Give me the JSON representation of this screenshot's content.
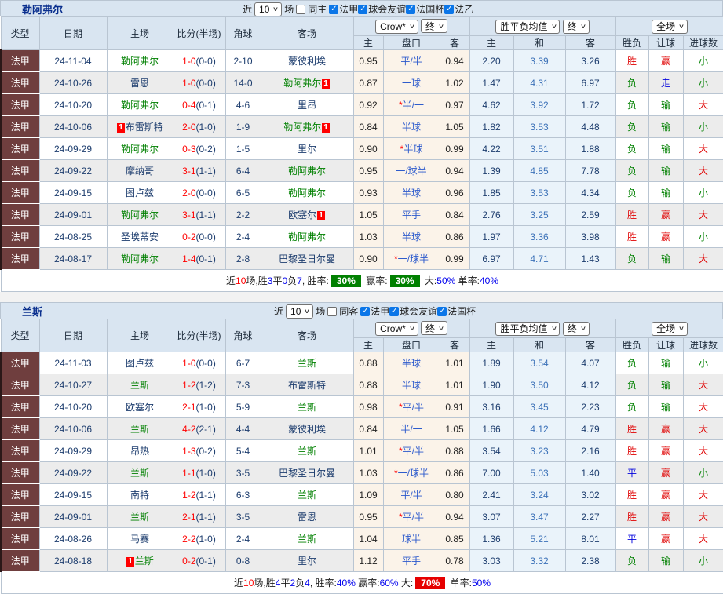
{
  "colors": {
    "header_bg": "#d9e5f1",
    "type_cell_bg": "#6f3e3e",
    "team_highlight_green": "#008000",
    "score_red": "#ff0000",
    "win_red": "#e00000",
    "draw_blue": "#0000dd",
    "lose_green": "#008000",
    "handicap_col_bg": "#fbf3e9",
    "odds_col_bg": "#eaf3fa",
    "badge_green": "#008000",
    "badge_red": "#e60000"
  },
  "headers": {
    "type": "类型",
    "date": "日期",
    "home": "主场",
    "score": "比分(半场)",
    "corner": "角球",
    "away": "客场",
    "h_home": "主",
    "h_line": "盘口",
    "h_away": "客",
    "o_home": "主",
    "o_draw": "和",
    "o_away": "客",
    "result": "胜负",
    "h_result": "让球",
    "goals": "进球数"
  },
  "tables": [
    {
      "title": "勒阿弗尔",
      "filter": {
        "near": "近",
        "count": "10",
        "matches": "场",
        "same": "同主"
      },
      "leagues": [
        "法甲",
        "球会友谊",
        "法国杯",
        "法乙"
      ],
      "dropdowns": {
        "bookmaker": "Crow*",
        "bookmaker_time": "终",
        "avg": "胜平负均值",
        "avg_time": "终",
        "scope": "全场"
      },
      "rows": [
        {
          "league": "法甲",
          "date": "24-11-04",
          "home": "勒阿弗尔",
          "hg": true,
          "hc": "",
          "away": "蒙彼利埃",
          "ag": false,
          "ac": "",
          "score": "1-0",
          "half": "(0-0)",
          "corner": "2-10",
          "ah": "0.95",
          "line": "平/半",
          "star": false,
          "aa": "0.94",
          "o1": "2.20",
          "o2": "3.39",
          "o3": "3.26",
          "res": "胜",
          "hres": "赢",
          "goal": "小"
        },
        {
          "league": "法甲",
          "date": "24-10-26",
          "home": "雷恩",
          "hg": false,
          "hc": "",
          "away": "勒阿弗尔",
          "ag": true,
          "ac": "1",
          "score": "1-0",
          "half": "(0-0)",
          "corner": "14-0",
          "ah": "0.87",
          "line": "一球",
          "star": false,
          "aa": "1.02",
          "o1": "1.47",
          "o2": "4.31",
          "o3": "6.97",
          "res": "负",
          "hres": "走",
          "goal": "小"
        },
        {
          "league": "法甲",
          "date": "24-10-20",
          "home": "勒阿弗尔",
          "hg": true,
          "hc": "",
          "away": "里昂",
          "ag": false,
          "ac": "",
          "score": "0-4",
          "half": "(0-1)",
          "corner": "4-6",
          "ah": "0.92",
          "line": "半/一",
          "star": true,
          "aa": "0.97",
          "o1": "4.62",
          "o2": "3.92",
          "o3": "1.72",
          "res": "负",
          "hres": "输",
          "goal": "大"
        },
        {
          "league": "法甲",
          "date": "24-10-06",
          "home": "布雷斯特",
          "hg": false,
          "hc": "1",
          "away": "勒阿弗尔",
          "ag": true,
          "ac": "1",
          "score": "2-0",
          "half": "(1-0)",
          "corner": "1-9",
          "ah": "0.84",
          "line": "半球",
          "star": false,
          "aa": "1.05",
          "o1": "1.82",
          "o2": "3.53",
          "o3": "4.48",
          "res": "负",
          "hres": "输",
          "goal": "小"
        },
        {
          "league": "法甲",
          "date": "24-09-29",
          "home": "勒阿弗尔",
          "hg": true,
          "hc": "",
          "away": "里尔",
          "ag": false,
          "ac": "",
          "score": "0-3",
          "half": "(0-2)",
          "corner": "1-5",
          "ah": "0.90",
          "line": "半球",
          "star": true,
          "aa": "0.99",
          "o1": "4.22",
          "o2": "3.51",
          "o3": "1.88",
          "res": "负",
          "hres": "输",
          "goal": "大"
        },
        {
          "league": "法甲",
          "date": "24-09-22",
          "home": "摩纳哥",
          "hg": false,
          "hc": "",
          "away": "勒阿弗尔",
          "ag": true,
          "ac": "",
          "score": "3-1",
          "half": "(1-1)",
          "corner": "6-4",
          "ah": "0.95",
          "line": "一/球半",
          "star": false,
          "aa": "0.94",
          "o1": "1.39",
          "o2": "4.85",
          "o3": "7.78",
          "res": "负",
          "hres": "输",
          "goal": "大"
        },
        {
          "league": "法甲",
          "date": "24-09-15",
          "home": "图卢兹",
          "hg": false,
          "hc": "",
          "away": "勒阿弗尔",
          "ag": true,
          "ac": "",
          "score": "2-0",
          "half": "(0-0)",
          "corner": "6-5",
          "ah": "0.93",
          "line": "半球",
          "star": false,
          "aa": "0.96",
          "o1": "1.85",
          "o2": "3.53",
          "o3": "4.34",
          "res": "负",
          "hres": "输",
          "goal": "小"
        },
        {
          "league": "法甲",
          "date": "24-09-01",
          "home": "勒阿弗尔",
          "hg": true,
          "hc": "",
          "away": "欧塞尔",
          "ag": false,
          "ac": "1",
          "score": "3-1",
          "half": "(1-1)",
          "corner": "2-2",
          "ah": "1.05",
          "line": "平手",
          "star": false,
          "aa": "0.84",
          "o1": "2.76",
          "o2": "3.25",
          "o3": "2.59",
          "res": "胜",
          "hres": "赢",
          "goal": "大"
        },
        {
          "league": "法甲",
          "date": "24-08-25",
          "home": "圣埃蒂安",
          "hg": false,
          "hc": "",
          "away": "勒阿弗尔",
          "ag": true,
          "ac": "",
          "score": "0-2",
          "half": "(0-0)",
          "corner": "2-4",
          "ah": "1.03",
          "line": "半球",
          "star": false,
          "aa": "0.86",
          "o1": "1.97",
          "o2": "3.36",
          "o3": "3.98",
          "res": "胜",
          "hres": "赢",
          "goal": "小"
        },
        {
          "league": "法甲",
          "date": "24-08-17",
          "home": "勒阿弗尔",
          "hg": true,
          "hc": "",
          "away": "巴黎圣日尔曼",
          "ag": false,
          "ac": "",
          "score": "1-4",
          "half": "(0-1)",
          "corner": "2-8",
          "ah": "0.90",
          "line": "一/球半",
          "star": true,
          "aa": "0.99",
          "o1": "6.97",
          "o2": "4.71",
          "o3": "1.43",
          "res": "负",
          "hres": "输",
          "goal": "大"
        }
      ],
      "summary": [
        {
          "text": "近",
          "style": "plain"
        },
        {
          "text": "10",
          "style": "red"
        },
        {
          "text": "场,胜",
          "style": "plain"
        },
        {
          "text": "3",
          "style": "blue"
        },
        {
          "text": "平",
          "style": "plain"
        },
        {
          "text": "0",
          "style": "blue"
        },
        {
          "text": "负",
          "style": "plain"
        },
        {
          "text": "7",
          "style": "blue"
        },
        {
          "text": ", 胜率:",
          "style": "plain"
        },
        {
          "text": "30%",
          "style": "badge-green"
        },
        {
          "text": " 赢率:",
          "style": "plain"
        },
        {
          "text": "30%",
          "style": "badge-green"
        },
        {
          "text": " 大:",
          "style": "plain"
        },
        {
          "text": "50%",
          "style": "blue"
        },
        {
          "text": " 单率:",
          "style": "plain"
        },
        {
          "text": "40%",
          "style": "blue"
        }
      ]
    },
    {
      "title": "兰斯",
      "filter": {
        "near": "近",
        "count": "10",
        "matches": "场",
        "same": "同客"
      },
      "leagues": [
        "法甲",
        "球会友谊",
        "法国杯"
      ],
      "dropdowns": {
        "bookmaker": "Crow*",
        "bookmaker_time": "终",
        "avg": "胜平负均值",
        "avg_time": "终",
        "scope": "全场"
      },
      "rows": [
        {
          "league": "法甲",
          "date": "24-11-03",
          "home": "图卢兹",
          "hg": false,
          "hc": "",
          "away": "兰斯",
          "ag": true,
          "ac": "",
          "score": "1-0",
          "half": "(0-0)",
          "corner": "6-7",
          "ah": "0.88",
          "line": "半球",
          "star": false,
          "aa": "1.01",
          "o1": "1.89",
          "o2": "3.54",
          "o3": "4.07",
          "res": "负",
          "hres": "输",
          "goal": "小"
        },
        {
          "league": "法甲",
          "date": "24-10-27",
          "home": "兰斯",
          "hg": true,
          "hc": "",
          "away": "布雷斯特",
          "ag": false,
          "ac": "",
          "score": "1-2",
          "half": "(1-2)",
          "corner": "7-3",
          "ah": "0.88",
          "line": "半球",
          "star": false,
          "aa": "1.01",
          "o1": "1.90",
          "o2": "3.50",
          "o3": "4.12",
          "res": "负",
          "hres": "输",
          "goal": "大"
        },
        {
          "league": "法甲",
          "date": "24-10-20",
          "home": "欧塞尔",
          "hg": false,
          "hc": "",
          "away": "兰斯",
          "ag": true,
          "ac": "",
          "score": "2-1",
          "half": "(1-0)",
          "corner": "5-9",
          "ah": "0.98",
          "line": "平/半",
          "star": true,
          "aa": "0.91",
          "o1": "3.16",
          "o2": "3.45",
          "o3": "2.23",
          "res": "负",
          "hres": "输",
          "goal": "大"
        },
        {
          "league": "法甲",
          "date": "24-10-06",
          "home": "兰斯",
          "hg": true,
          "hc": "",
          "away": "蒙彼利埃",
          "ag": false,
          "ac": "",
          "score": "4-2",
          "half": "(2-1)",
          "corner": "4-4",
          "ah": "0.84",
          "line": "半/一",
          "star": false,
          "aa": "1.05",
          "o1": "1.66",
          "o2": "4.12",
          "o3": "4.79",
          "res": "胜",
          "hres": "赢",
          "goal": "大"
        },
        {
          "league": "法甲",
          "date": "24-09-29",
          "home": "昂热",
          "hg": false,
          "hc": "",
          "away": "兰斯",
          "ag": true,
          "ac": "",
          "score": "1-3",
          "half": "(0-2)",
          "corner": "5-4",
          "ah": "1.01",
          "line": "平/半",
          "star": true,
          "aa": "0.88",
          "o1": "3.54",
          "o2": "3.23",
          "o3": "2.16",
          "res": "胜",
          "hres": "赢",
          "goal": "大"
        },
        {
          "league": "法甲",
          "date": "24-09-22",
          "home": "兰斯",
          "hg": true,
          "hc": "",
          "away": "巴黎圣日尔曼",
          "ag": false,
          "ac": "",
          "score": "1-1",
          "half": "(1-0)",
          "corner": "3-5",
          "ah": "1.03",
          "line": "一/球半",
          "star": true,
          "aa": "0.86",
          "o1": "7.00",
          "o2": "5.03",
          "o3": "1.40",
          "res": "平",
          "hres": "赢",
          "goal": "小"
        },
        {
          "league": "法甲",
          "date": "24-09-15",
          "home": "南特",
          "hg": false,
          "hc": "",
          "away": "兰斯",
          "ag": true,
          "ac": "",
          "score": "1-2",
          "half": "(1-1)",
          "corner": "6-3",
          "ah": "1.09",
          "line": "平/半",
          "star": false,
          "aa": "0.80",
          "o1": "2.41",
          "o2": "3.24",
          "o3": "3.02",
          "res": "胜",
          "hres": "赢",
          "goal": "大"
        },
        {
          "league": "法甲",
          "date": "24-09-01",
          "home": "兰斯",
          "hg": true,
          "hc": "",
          "away": "雷恩",
          "ag": false,
          "ac": "",
          "score": "2-1",
          "half": "(1-1)",
          "corner": "3-5",
          "ah": "0.95",
          "line": "平/半",
          "star": true,
          "aa": "0.94",
          "o1": "3.07",
          "o2": "3.47",
          "o3": "2.27",
          "res": "胜",
          "hres": "赢",
          "goal": "大"
        },
        {
          "league": "法甲",
          "date": "24-08-26",
          "home": "马赛",
          "hg": false,
          "hc": "",
          "away": "兰斯",
          "ag": true,
          "ac": "",
          "score": "2-2",
          "half": "(1-0)",
          "corner": "2-4",
          "ah": "1.04",
          "line": "球半",
          "star": false,
          "aa": "0.85",
          "o1": "1.36",
          "o2": "5.21",
          "o3": "8.01",
          "res": "平",
          "hres": "赢",
          "goal": "大"
        },
        {
          "league": "法甲",
          "date": "24-08-18",
          "home": "兰斯",
          "hg": true,
          "hc": "1",
          "away": "里尔",
          "ag": false,
          "ac": "",
          "score": "0-2",
          "half": "(0-1)",
          "corner": "0-8",
          "ah": "1.12",
          "line": "平手",
          "star": false,
          "aa": "0.78",
          "o1": "3.03",
          "o2": "3.32",
          "o3": "2.38",
          "res": "负",
          "hres": "输",
          "goal": "小"
        }
      ],
      "summary": [
        {
          "text": "近",
          "style": "plain"
        },
        {
          "text": "10",
          "style": "red"
        },
        {
          "text": "场,胜",
          "style": "plain"
        },
        {
          "text": "4",
          "style": "blue"
        },
        {
          "text": "平",
          "style": "plain"
        },
        {
          "text": "2",
          "style": "blue"
        },
        {
          "text": "负",
          "style": "plain"
        },
        {
          "text": "4",
          "style": "blue"
        },
        {
          "text": ", 胜率:",
          "style": "plain"
        },
        {
          "text": "40%",
          "style": "blue"
        },
        {
          "text": " 赢率:",
          "style": "plain"
        },
        {
          "text": "60%",
          "style": "blue"
        },
        {
          "text": " 大:",
          "style": "plain"
        },
        {
          "text": "70%",
          "style": "badge-red"
        },
        {
          "text": " 单率:",
          "style": "plain"
        },
        {
          "text": "50%",
          "style": "blue"
        }
      ]
    }
  ]
}
